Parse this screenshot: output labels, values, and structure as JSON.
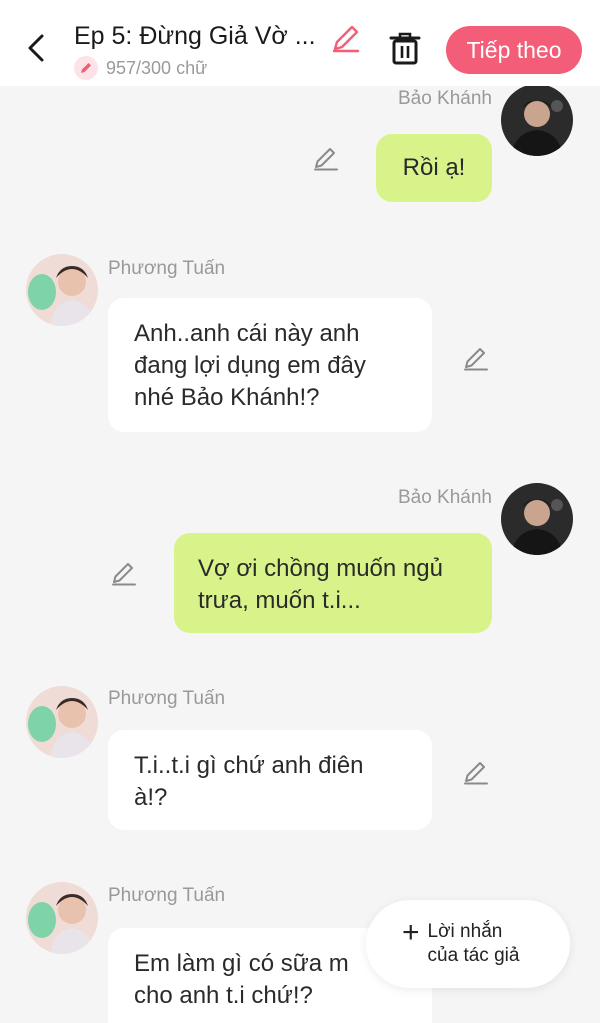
{
  "header": {
    "title": "Ep 5: Đừng Giả Vờ ...",
    "word_count": "957/300 chữ",
    "next_label": "Tiếp theo",
    "accent_color": "#f35d77"
  },
  "messages": [
    {
      "sender": "Bảo Khánh",
      "text": "Rồi ạ!",
      "side": "right",
      "bubble_color": "#d7f38a"
    },
    {
      "sender": "Phương Tuấn",
      "text": "Anh..anh cái này anh đang lợi dụng em đây nhé Bảo Khánh!?",
      "line1": "Anh..anh cái này anh",
      "line2": "đang lợi dụng em đây",
      "line3": "nhé Bảo Khánh!?",
      "side": "left",
      "bubble_color": "#ffffff"
    },
    {
      "sender": "Bảo Khánh",
      "line1": "Vợ ơi chồng muốn ngủ",
      "line2": "trưa, muốn t.i...",
      "side": "right",
      "bubble_color": "#d7f38a"
    },
    {
      "sender": "Phương Tuấn",
      "line1": "T.i..t.i gì chứ anh điên",
      "line2": "à!?",
      "side": "left",
      "bubble_color": "#ffffff"
    },
    {
      "sender": "Phương Tuấn",
      "line1": "Em làm gì có sữa m",
      "line2": "cho anh t.i chứ!?",
      "side": "left",
      "bubble_color": "#ffffff"
    }
  ],
  "author_note": {
    "line1": "Lời nhắn",
    "line2": "của tác giả"
  },
  "icons": [
    "back-arrow-icon",
    "pencil-icon",
    "trash-icon",
    "plus-icon"
  ]
}
